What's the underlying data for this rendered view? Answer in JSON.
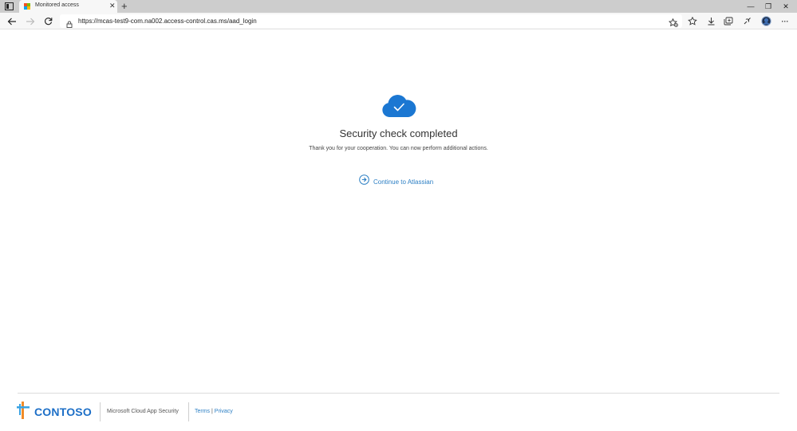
{
  "browser": {
    "tab": {
      "title": "Monitored access",
      "close_glyph": "✕"
    },
    "new_tab_glyph": "+",
    "address": {
      "url": "https://mcas-test9-com.na002.access-control.cas.ms/aad_login"
    },
    "window_controls": {
      "minimize": "—",
      "restore": "❐",
      "close": "✕"
    },
    "toolbar_icons": [
      "favorites-star-add-icon",
      "favorites-icon",
      "downloads-icon",
      "collections-icon",
      "extensions-icon",
      "profile-icon",
      "more-icon"
    ],
    "more_glyph": "···"
  },
  "main": {
    "title": "Security check completed",
    "subtitle": "Thank you for your cooperation. You can now perform additional actions.",
    "continue_label": "Continue to Atlassian",
    "accent_color": "#2c7fc4",
    "cloud_color": "#1b77d2"
  },
  "footer": {
    "logo_text": "CONTOSO",
    "product": "Microsoft Cloud App Security",
    "terms": "Terms",
    "separator": "|",
    "privacy": "Privacy"
  }
}
